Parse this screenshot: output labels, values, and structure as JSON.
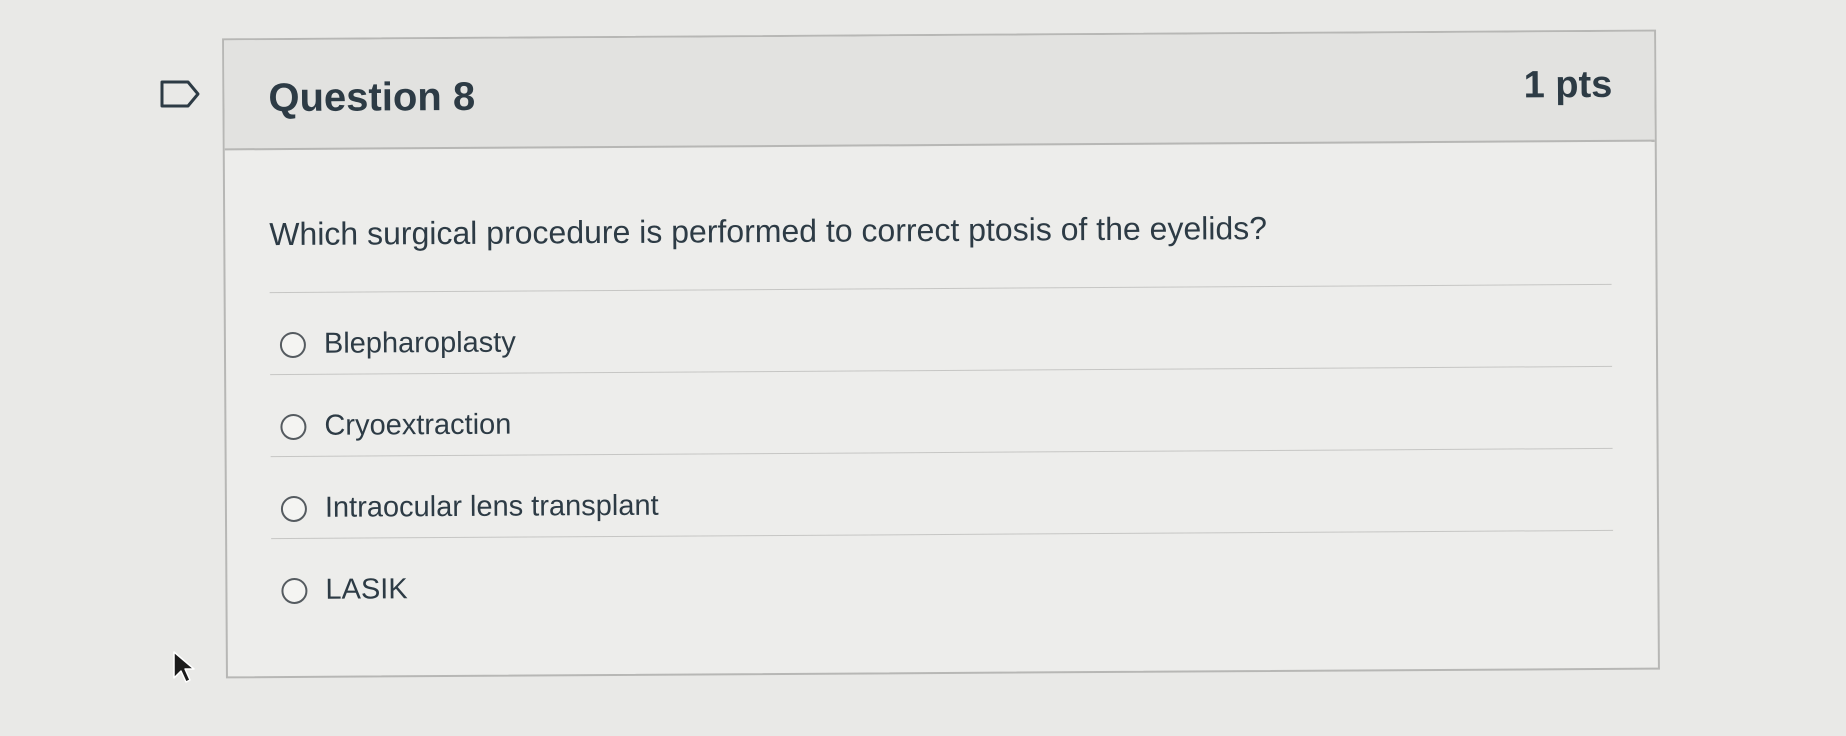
{
  "question": {
    "title": "Question 8",
    "points": "1 pts",
    "text": "Which surgical procedure is performed to correct ptosis of the eyelids?",
    "answers": [
      {
        "label": "Blepharoplasty",
        "selected": false
      },
      {
        "label": "Cryoextraction",
        "selected": false
      },
      {
        "label": "Intraocular lens transplant",
        "selected": false
      },
      {
        "label": "LASIK",
        "selected": false
      }
    ]
  },
  "icons": {
    "flag": "flag-question-icon",
    "cursor": "mouse-pointer-icon",
    "radio": "radio-unselected-icon"
  },
  "colors": {
    "text": "#2d3b45",
    "border": "#b7b7b5",
    "header_bg": "#e2e2e0",
    "page_bg": "#e9e9e7"
  }
}
